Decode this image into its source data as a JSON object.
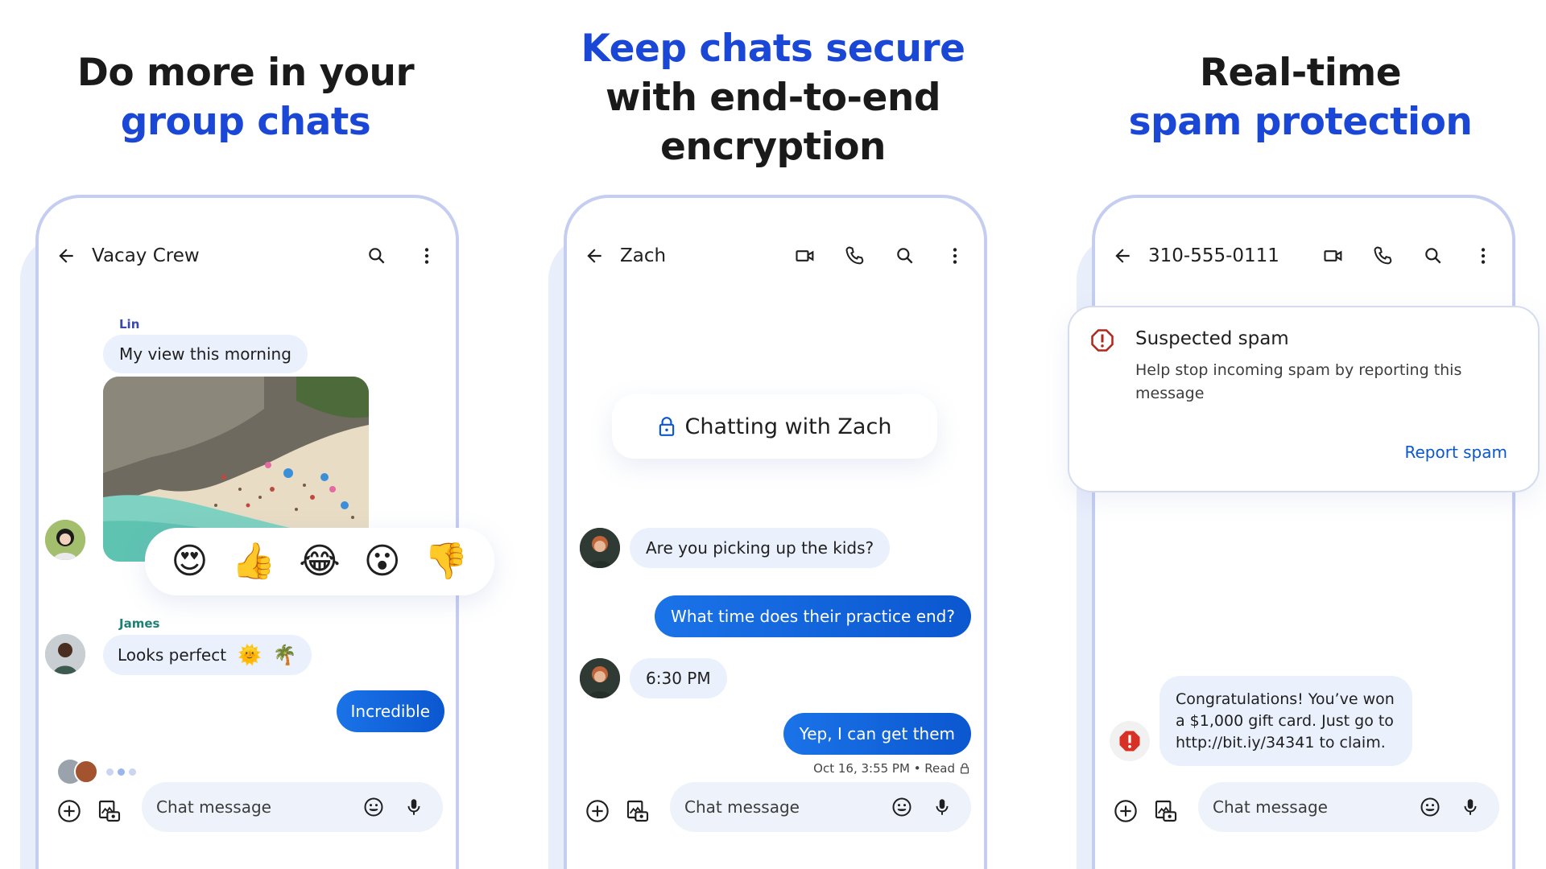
{
  "panels": [
    {
      "headline": {
        "line1": "Do more in your",
        "line2": "group chats"
      },
      "chat_title": "Vacay Crew",
      "messages": [
        {
          "sender": "Lin",
          "text": "My view this morning"
        },
        {
          "sender": "James",
          "text": "Looks perfect",
          "emoji": [
            "🌞",
            "🌴"
          ]
        },
        {
          "outgoing": true,
          "text": "Incredible"
        }
      ],
      "reactions": [
        "😍",
        "👍",
        "😂",
        "😮",
        "👎"
      ],
      "composer_placeholder": "Chat message"
    },
    {
      "headline": {
        "line1": "Keep chats secure",
        "line2": "with end-to-end",
        "line3": "encryption"
      },
      "chat_title": "Zach",
      "encryption_banner": "Chatting with Zach",
      "messages": [
        {
          "text": "Are you picking up the kids?"
        },
        {
          "outgoing": true,
          "text": "What time does their practice end?"
        },
        {
          "text": "6:30 PM"
        },
        {
          "outgoing": true,
          "text": "Yep, I can get them"
        }
      ],
      "status": "Oct 16, 3:55 PM • Read",
      "composer_placeholder": "Chat message"
    },
    {
      "headline": {
        "line1": "Real-time",
        "line2": "spam protection"
      },
      "chat_title": "310-555-0111",
      "spam_card": {
        "title": "Suspected spam",
        "body": "Help stop incoming spam by reporting this message",
        "action": "Report spam"
      },
      "messages": [
        {
          "text": "Congratulations! You’ve won a $1,000 gift card. Just go to http://bit.iy/34341 to claim."
        }
      ],
      "composer_placeholder": "Chat message"
    }
  ],
  "colors": {
    "brand_blue": "#1a47d6",
    "outgoing_bubble": "#0b57d0",
    "incoming_bubble": "#eaf0fc",
    "phone_frame": "#c5cdf0",
    "spam_red": "#d93025",
    "lin_color": "#3949ab",
    "james_color": "#1e7f74"
  },
  "icons": [
    "back-arrow-icon",
    "search-icon",
    "more-vert-icon",
    "video-call-icon",
    "phone-icon",
    "add-icon",
    "gallery-icon",
    "emoji-icon",
    "mic-icon",
    "lock-icon",
    "spam-warning-icon"
  ]
}
